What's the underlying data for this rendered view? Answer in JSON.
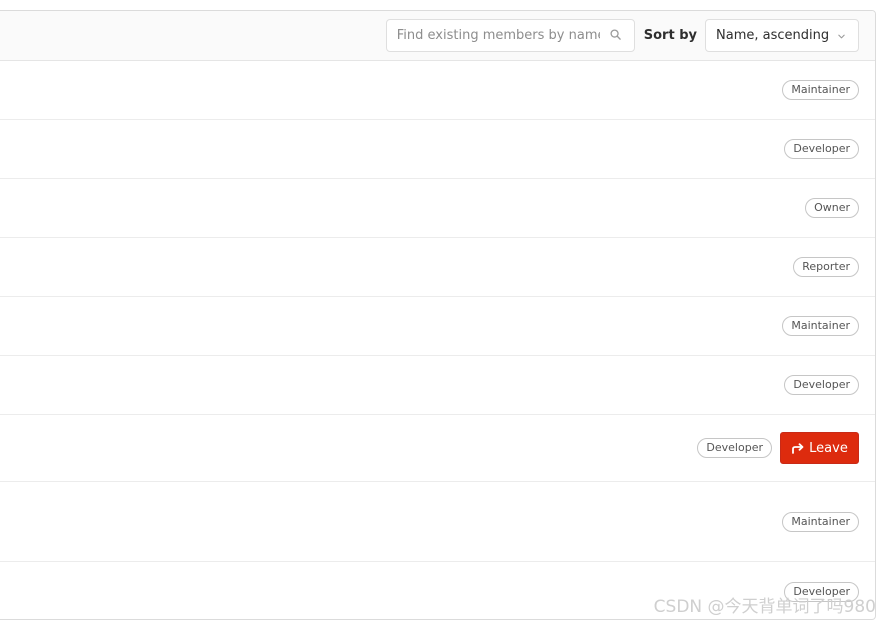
{
  "toolbar": {
    "search_placeholder": "Find existing members by name",
    "search_value": "",
    "search_icon": "search-icon",
    "sort_label": "Sort by",
    "sort_selected": "Name, ascending",
    "sort_chevron_icon": "chevron-down-icon"
  },
  "members": [
    {
      "role": "Maintainer"
    },
    {
      "role": "Developer"
    },
    {
      "role": "Owner"
    },
    {
      "role": "Reporter"
    },
    {
      "role": "Maintainer"
    },
    {
      "role": "Developer"
    },
    {
      "role": "Developer",
      "action_label": "Leave",
      "action_icon": "leave-icon"
    },
    {
      "role": "Maintainer"
    },
    {
      "role": "Developer"
    }
  ],
  "colors": {
    "danger": "#dd2b0e",
    "header_bg": "#fafafa",
    "border": "#dbdbdb"
  },
  "watermark": "CSDN @今天背单词了吗980"
}
